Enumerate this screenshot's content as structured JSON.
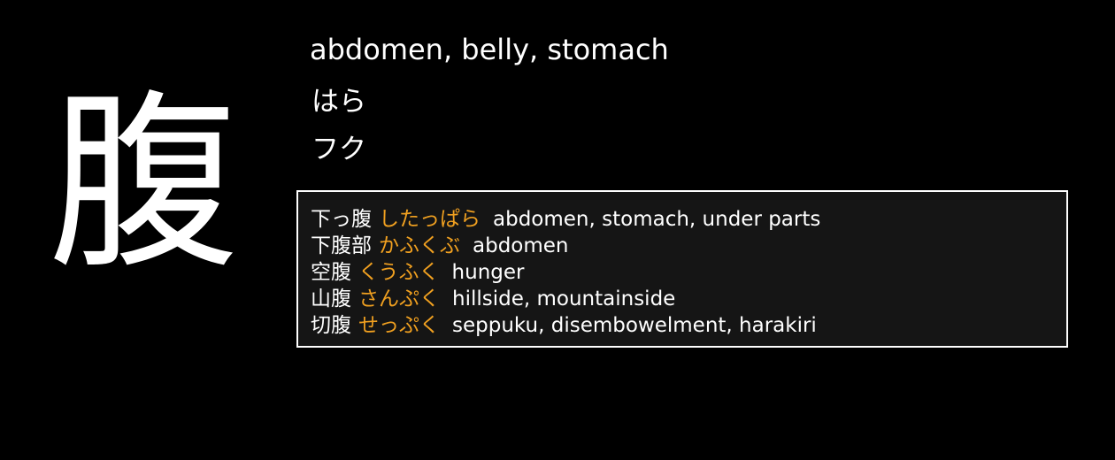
{
  "kanji": "腹",
  "meaning": "abdomen, belly, stomach",
  "kun_reading": "はら",
  "on_reading": "フク",
  "colors": {
    "background": "#000000",
    "text": "#ffffff",
    "reading_accent": "#f0a020",
    "box_background": "#151515",
    "box_border": "#ffffff"
  },
  "examples": [
    {
      "word": "下っ腹",
      "reading": "したっぱら",
      "gloss": "abdomen, stomach, under parts"
    },
    {
      "word": "下腹部",
      "reading": "かふくぶ",
      "gloss": "abdomen"
    },
    {
      "word": "空腹",
      "reading": "くうふく",
      "gloss": "hunger"
    },
    {
      "word": "山腹",
      "reading": "さんぷく",
      "gloss": "hillside, mountainside"
    },
    {
      "word": "切腹",
      "reading": "せっぷく",
      "gloss": "seppuku, disembowelment, harakiri"
    }
  ]
}
